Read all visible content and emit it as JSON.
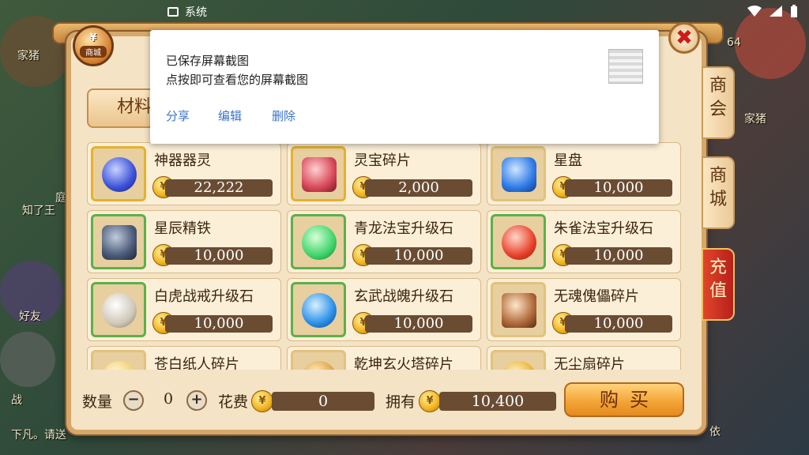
{
  "status_bar": {
    "app_label": "系统",
    "icons": [
      "image-icon",
      "wifi-icon",
      "signal-icon",
      "battery-icon"
    ]
  },
  "background": {
    "texts": [
      "家猪",
      "庭",
      "知了王",
      "好友",
      "家猪",
      "64",
      "战",
      "下凡。请送",
      "依"
    ]
  },
  "shop": {
    "badge_symbol": "¥",
    "badge_label": "商城",
    "close_symbol": "✖",
    "category_tab": "材料",
    "side_tabs": [
      {
        "label": "商会",
        "active": false
      },
      {
        "label": "商城",
        "active": false
      },
      {
        "label": "充值",
        "active": true
      }
    ],
    "items": [
      {
        "name": "神器器灵",
        "price": "22,222",
        "color": "#3a50d8",
        "frame": "gold"
      },
      {
        "name": "灵宝碎片",
        "price": "2,000",
        "color": "#d8485a",
        "frame": "plain"
      },
      {
        "name": "星盘",
        "price": "10,000",
        "color": "#2f7be8",
        "frame": "plain"
      },
      {
        "name": "星辰精铁",
        "price": "10,000",
        "color": "#4a5a78",
        "frame": "green"
      },
      {
        "name": "青龙法宝升级石",
        "price": "10,000",
        "color": "#3ed46a",
        "frame": "green"
      },
      {
        "name": "朱雀法宝升级石",
        "price": "10,000",
        "color": "#e8402a",
        "frame": "green"
      },
      {
        "name": "白虎战戒升级石",
        "price": "10,000",
        "color": "#cfc8b8",
        "frame": "green"
      },
      {
        "name": "玄武战魄升级石",
        "price": "10,000",
        "color": "#2a8ee8",
        "frame": "green"
      },
      {
        "name": "无魂傀儡碎片",
        "price": "10,000",
        "color": "#b06a3a",
        "frame": "plain"
      },
      {
        "name": "苍白纸人碎片",
        "price": "",
        "color": "#f0d070",
        "frame": "plain"
      },
      {
        "name": "乾坤玄火塔碎片",
        "price": "",
        "color": "#e0a040",
        "frame": "plain"
      },
      {
        "name": "无尘扇碎片",
        "price": "",
        "color": "#e8b030",
        "frame": "plain"
      }
    ],
    "bottom": {
      "qty_label": "数量",
      "minus": "−",
      "plus": "+",
      "qty_value": "0",
      "cost_label": "花费",
      "cost_value": "0",
      "own_label": "拥有",
      "own_value": "10,400",
      "buy_label": "购买"
    }
  },
  "notification": {
    "line1": "已保存屏幕截图",
    "line2": "点按即可查看您的屏幕截图",
    "actions": [
      "分享",
      "编辑",
      "删除"
    ]
  }
}
